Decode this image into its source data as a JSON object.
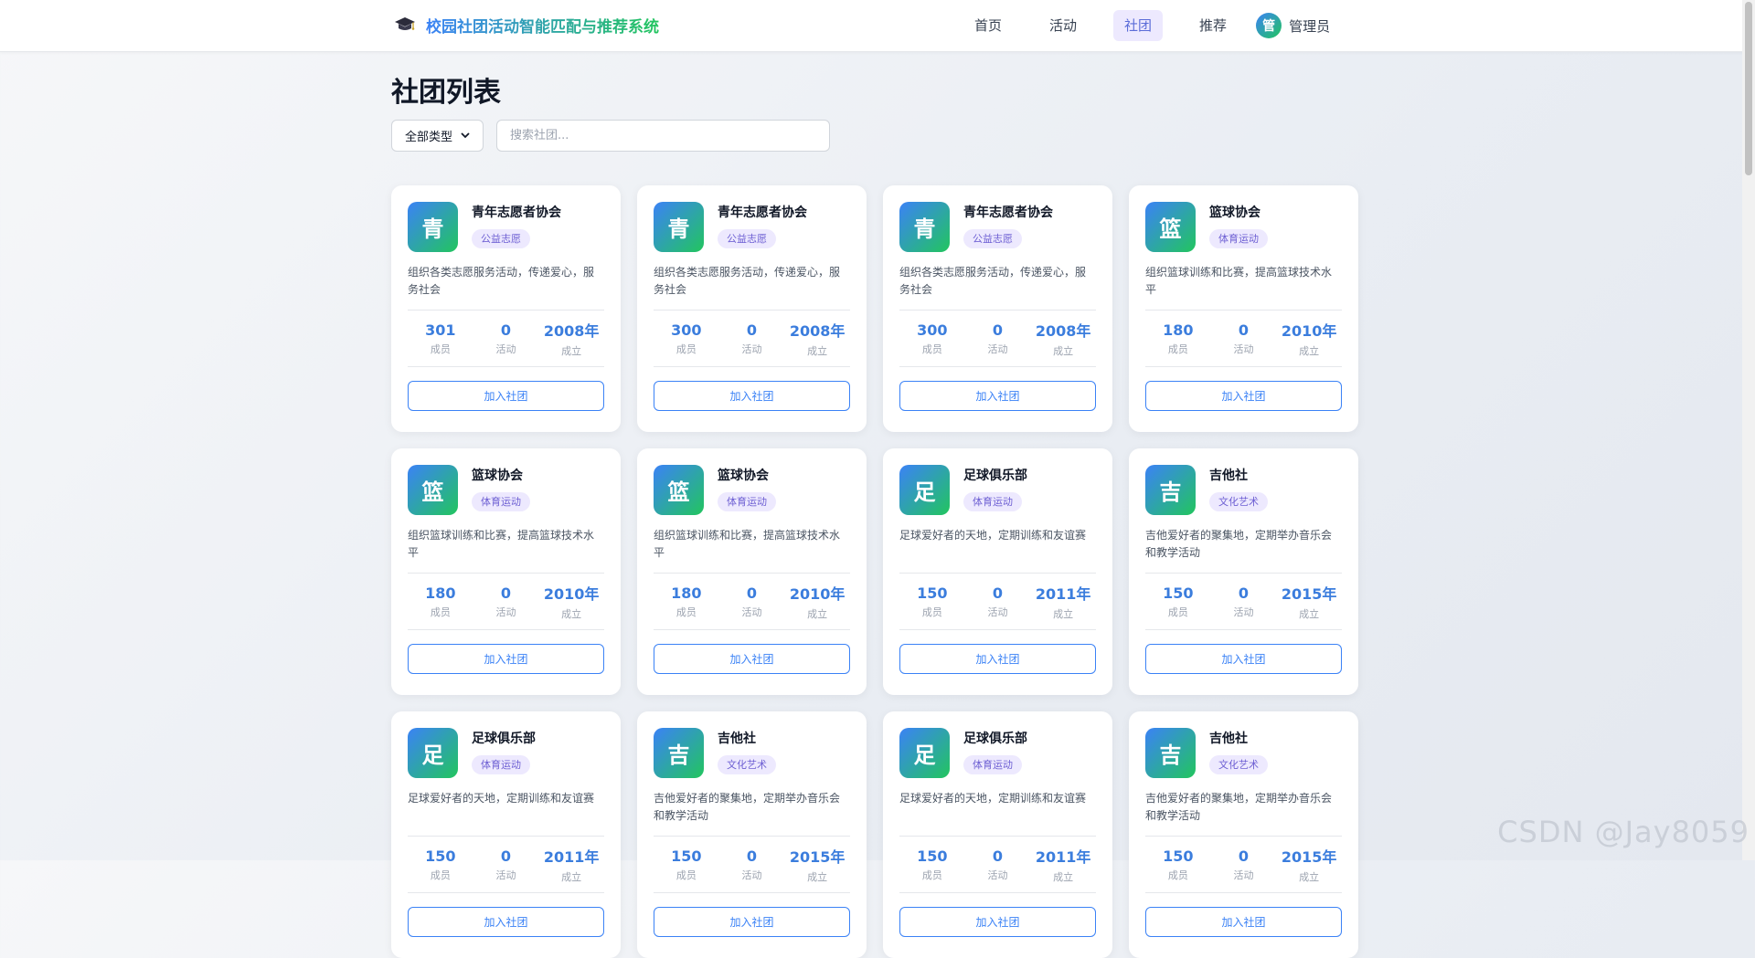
{
  "header": {
    "title": "校园社团活动智能匹配与推荐系统",
    "nav": [
      {
        "label": "首页",
        "active": false
      },
      {
        "label": "活动",
        "active": false
      },
      {
        "label": "社团",
        "active": true
      },
      {
        "label": "推荐",
        "active": false
      }
    ],
    "user": {
      "avatar_char": "管",
      "name": "管理员"
    }
  },
  "page": {
    "title": "社团列表",
    "filter": {
      "selected": "全部类型"
    },
    "search": {
      "placeholder": "搜索社团..."
    }
  },
  "stat_labels": {
    "members": "成员",
    "activities": "活动",
    "founded": "成立"
  },
  "join_label": "加入社团",
  "clubs": [
    {
      "badge": "青",
      "name": "青年志愿者协会",
      "tag": "公益志愿",
      "desc": "组织各类志愿服务活动，传递爱心，服务社会",
      "members": "301",
      "activities": "0",
      "founded": "2008年"
    },
    {
      "badge": "青",
      "name": "青年志愿者协会",
      "tag": "公益志愿",
      "desc": "组织各类志愿服务活动，传递爱心，服务社会",
      "members": "300",
      "activities": "0",
      "founded": "2008年"
    },
    {
      "badge": "青",
      "name": "青年志愿者协会",
      "tag": "公益志愿",
      "desc": "组织各类志愿服务活动，传递爱心，服务社会",
      "members": "300",
      "activities": "0",
      "founded": "2008年"
    },
    {
      "badge": "篮",
      "name": "篮球协会",
      "tag": "体育运动",
      "desc": "组织篮球训练和比赛，提高篮球技术水平",
      "members": "180",
      "activities": "0",
      "founded": "2010年"
    },
    {
      "badge": "篮",
      "name": "篮球协会",
      "tag": "体育运动",
      "desc": "组织篮球训练和比赛，提高篮球技术水平",
      "members": "180",
      "activities": "0",
      "founded": "2010年"
    },
    {
      "badge": "篮",
      "name": "篮球协会",
      "tag": "体育运动",
      "desc": "组织篮球训练和比赛，提高篮球技术水平",
      "members": "180",
      "activities": "0",
      "founded": "2010年"
    },
    {
      "badge": "足",
      "name": "足球俱乐部",
      "tag": "体育运动",
      "desc": "足球爱好者的天地，定期训练和友谊赛",
      "members": "150",
      "activities": "0",
      "founded": "2011年"
    },
    {
      "badge": "吉",
      "name": "吉他社",
      "tag": "文化艺术",
      "desc": "吉他爱好者的聚集地，定期举办音乐会和教学活动",
      "members": "150",
      "activities": "0",
      "founded": "2015年"
    },
    {
      "badge": "足",
      "name": "足球俱乐部",
      "tag": "体育运动",
      "desc": "足球爱好者的天地，定期训练和友谊赛",
      "members": "150",
      "activities": "0",
      "founded": "2011年"
    },
    {
      "badge": "吉",
      "name": "吉他社",
      "tag": "文化艺术",
      "desc": "吉他爱好者的聚集地，定期举办音乐会和教学活动",
      "members": "150",
      "activities": "0",
      "founded": "2015年"
    },
    {
      "badge": "足",
      "name": "足球俱乐部",
      "tag": "体育运动",
      "desc": "足球爱好者的天地，定期训练和友谊赛",
      "members": "150",
      "activities": "0",
      "founded": "2011年"
    },
    {
      "badge": "吉",
      "name": "吉他社",
      "tag": "文化艺术",
      "desc": "吉他爱好者的聚集地，定期举办音乐会和教学活动",
      "members": "150",
      "activities": "0",
      "founded": "2015年"
    }
  ],
  "watermark": "CSDN @Jay8059"
}
